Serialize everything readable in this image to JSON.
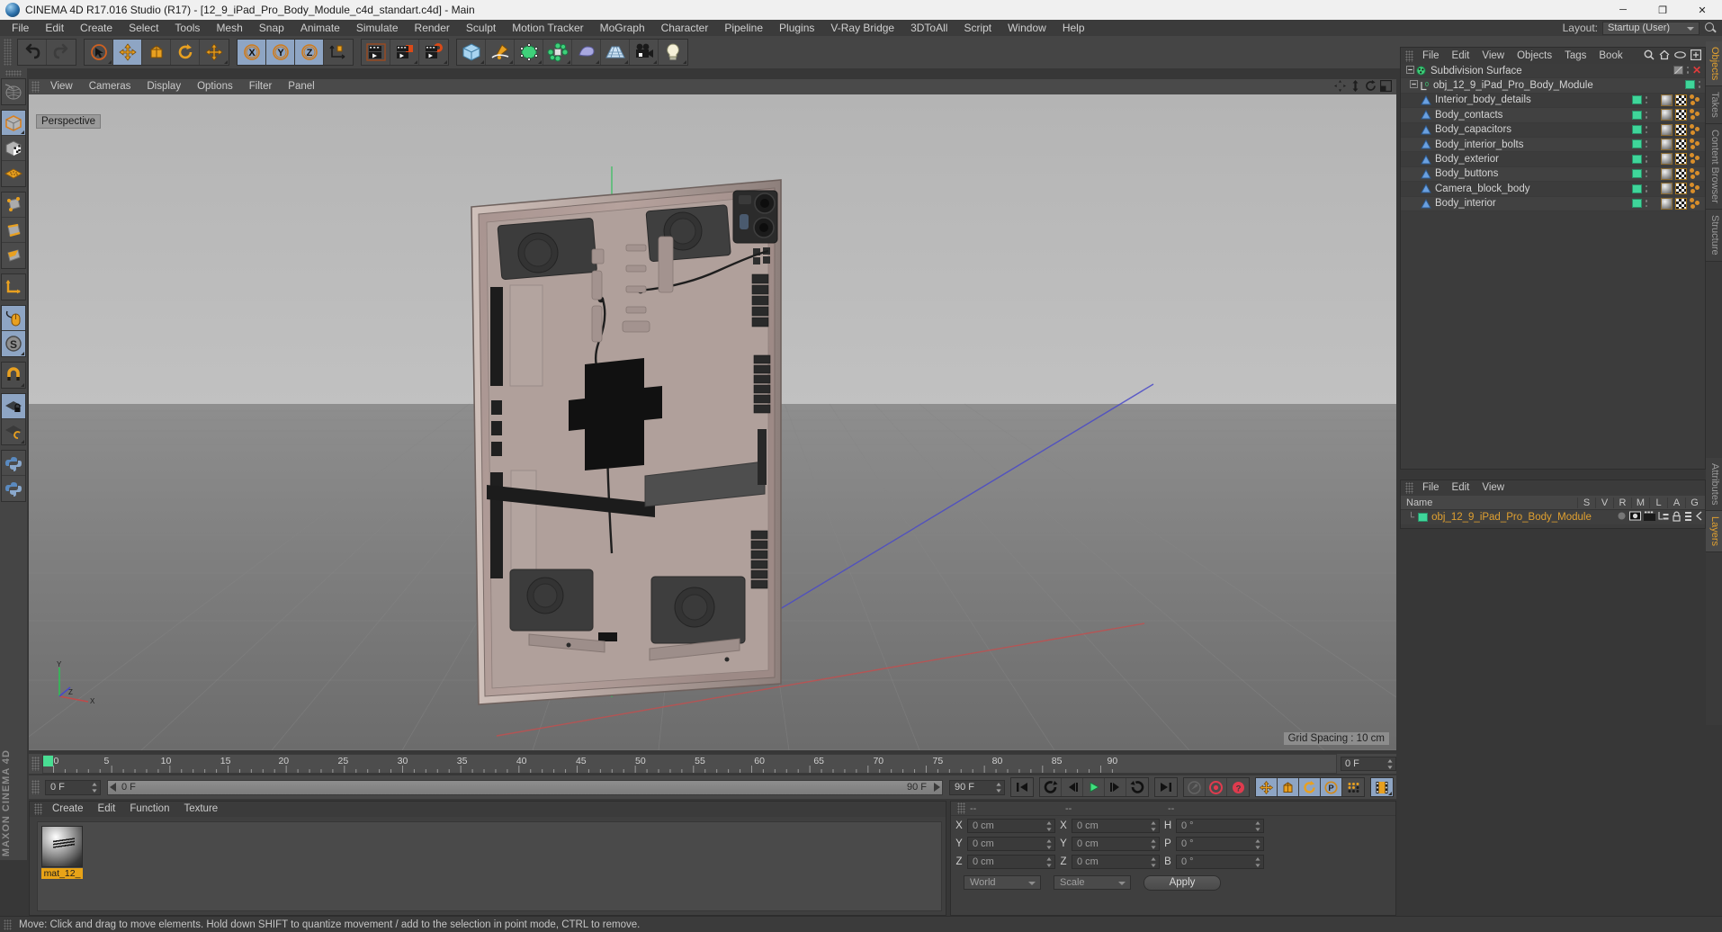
{
  "window": {
    "title": "CINEMA 4D R17.016 Studio (R17) - [12_9_iPad_Pro_Body_Module_c4d_standart.c4d] - Main",
    "minimize": "─",
    "maximize": "❐",
    "close": "✕",
    "app_icon": "cinema4d-logo-icon"
  },
  "menubar": {
    "items": [
      {
        "label": "File"
      },
      {
        "label": "Edit"
      },
      {
        "label": "Create"
      },
      {
        "label": "Select"
      },
      {
        "label": "Tools"
      },
      {
        "label": "Mesh"
      },
      {
        "label": "Snap"
      },
      {
        "label": "Animate"
      },
      {
        "label": "Simulate"
      },
      {
        "label": "Render"
      },
      {
        "label": "Sculpt"
      },
      {
        "label": "Motion Tracker"
      },
      {
        "label": "MoGraph"
      },
      {
        "label": "Character"
      },
      {
        "label": "Pipeline"
      },
      {
        "label": "Plugins"
      },
      {
        "label": "V-Ray Bridge"
      },
      {
        "label": "3DToAll"
      },
      {
        "label": "Script"
      },
      {
        "label": "Window"
      },
      {
        "label": "Help"
      }
    ],
    "layout_label": "Layout:",
    "layout_value": "Startup (User)"
  },
  "toolbar": {
    "groups": [
      {
        "buttons": [
          {
            "name": "undo-button",
            "icon": "undo-icon",
            "active": false
          },
          {
            "name": "redo-button",
            "icon": "redo-icon",
            "active": false
          }
        ]
      },
      {
        "buttons": [
          {
            "name": "live-selection-button",
            "icon": "cursor-select-icon",
            "active": false
          },
          {
            "name": "move-button",
            "icon": "move-arrows-icon",
            "active": true
          },
          {
            "name": "scale-button",
            "icon": "scale-box-icon",
            "active": false
          },
          {
            "name": "rotate-button",
            "icon": "rotate-icon",
            "active": false
          },
          {
            "name": "dynamic-place-button",
            "icon": "move-arrows-icon",
            "active": false
          }
        ]
      },
      {
        "buttons": [
          {
            "name": "axis-x-button",
            "icon": "axis-x-icon",
            "active": true
          },
          {
            "name": "axis-y-button",
            "icon": "axis-y-icon",
            "active": true
          },
          {
            "name": "axis-z-button",
            "icon": "axis-z-icon",
            "active": true
          },
          {
            "name": "world-coordinates-button",
            "icon": "world-axis-cube-icon",
            "active": false
          }
        ]
      },
      {
        "buttons": [
          {
            "name": "render-view-button",
            "icon": "clapper-icon",
            "active": false
          },
          {
            "name": "render-to-picture-viewer-button",
            "icon": "clapper-red-icon",
            "active": false
          },
          {
            "name": "render-settings-button",
            "icon": "clapper-gear-icon",
            "active": false
          }
        ]
      },
      {
        "buttons": [
          {
            "name": "add-cube-button",
            "icon": "blue-cube-icon",
            "active": false
          },
          {
            "name": "add-spline-button",
            "icon": "pen-spline-icon",
            "active": false
          },
          {
            "name": "add-generator-button",
            "icon": "green-cube-icon",
            "active": false
          },
          {
            "name": "add-cloner-button",
            "icon": "mograph-cluster-icon",
            "active": false
          },
          {
            "name": "add-deformer-button",
            "icon": "bend-deformer-icon",
            "active": false
          },
          {
            "name": "add-scene-object-button",
            "icon": "floor-grid-icon",
            "active": false
          },
          {
            "name": "add-camera-button",
            "icon": "camera-icon",
            "active": false
          },
          {
            "name": "add-light-button",
            "icon": "light-bulb-icon",
            "active": false
          }
        ]
      }
    ]
  },
  "left_toolbar": {
    "buttons": [
      {
        "name": "live-selection-tool",
        "icon": "globe-selection-icon",
        "active": false
      },
      {
        "name": "model-mode-tool",
        "icon": "model-cube-icon",
        "active": true
      },
      {
        "name": "texture-mode-tool",
        "icon": "texture-cube-icon",
        "active": false
      },
      {
        "name": "workplane-mode-tool",
        "icon": "workplane-grid-icon",
        "active": false
      },
      {
        "name": "points-mode-tool",
        "icon": "points-cube-icon",
        "active": false
      },
      {
        "name": "edges-mode-tool",
        "icon": "edges-cube-icon",
        "active": false
      },
      {
        "name": "polygons-mode-tool",
        "icon": "polygons-cube-icon",
        "active": false
      },
      {
        "name": "object-axis-tool",
        "icon": "axis-corner-icon",
        "active": false
      },
      {
        "name": "viewport-solo-tool",
        "icon": "mouse-icon",
        "active": true
      },
      {
        "name": "enable-snap-tool",
        "icon": "snap-s-icon",
        "active": true
      },
      {
        "name": "magnet-tool",
        "icon": "magnet-icon",
        "active": false
      },
      {
        "name": "workplane-lock-tool",
        "icon": "grid-lock-icon",
        "active": true
      },
      {
        "name": "workplane-align-tool",
        "icon": "grid-rotate-icon",
        "active": false
      },
      {
        "name": "python-script-tool-1",
        "icon": "python-icon",
        "active": false
      },
      {
        "name": "python-script-tool-2",
        "icon": "python-icon",
        "active": false
      }
    ],
    "brand": "MAXON CINEMA 4D"
  },
  "viewport": {
    "menu": [
      {
        "label": "View"
      },
      {
        "label": "Cameras"
      },
      {
        "label": "Display"
      },
      {
        "label": "Options"
      },
      {
        "label": "Filter"
      },
      {
        "label": "Panel"
      }
    ],
    "corner_icons": [
      {
        "name": "viewport-move-icon"
      },
      {
        "name": "viewport-scale-icon"
      },
      {
        "name": "viewport-rotate-icon"
      },
      {
        "name": "viewport-maximize-icon"
      }
    ],
    "camera_label": "Perspective",
    "grid_spacing": "Grid Spacing : 10 cm",
    "axis_labels": {
      "x": "X",
      "y": "Y",
      "z": "Z"
    },
    "model_description": "12.9 inch iPad Pro body module, rear interior view with speakers, camera block, logic board cutouts"
  },
  "object_manager": {
    "menu": [
      {
        "label": "File"
      },
      {
        "label": "Edit"
      },
      {
        "label": "View"
      },
      {
        "label": "Objects"
      },
      {
        "label": "Tags"
      },
      {
        "label": "Book"
      }
    ],
    "header_icons": [
      {
        "name": "search-icon"
      },
      {
        "name": "home-icon"
      },
      {
        "name": "eye-icon"
      },
      {
        "name": "expand-icon"
      }
    ],
    "rows": [
      {
        "label": "Subdivision Surface",
        "icon": "subdivision-surface-icon",
        "indent": 0,
        "enabled": "disabled",
        "has_tags": false,
        "disabled_mark": "✕"
      },
      {
        "label": "obj_12_9_iPad_Pro_Body_Module",
        "icon": "null-object-icon",
        "indent": 1,
        "enabled": "enabled",
        "has_tags": false
      },
      {
        "label": "Interior_body_details",
        "icon": "polygon-object-icon",
        "indent": 2,
        "enabled": "enabled",
        "has_tags": true
      },
      {
        "label": "Body_contacts",
        "icon": "polygon-object-icon",
        "indent": 2,
        "enabled": "enabled",
        "has_tags": true
      },
      {
        "label": "Body_capacitors",
        "icon": "polygon-object-icon",
        "indent": 2,
        "enabled": "enabled",
        "has_tags": true
      },
      {
        "label": "Body_interior_bolts",
        "icon": "polygon-object-icon",
        "indent": 2,
        "enabled": "enabled",
        "has_tags": true
      },
      {
        "label": "Body_exterior",
        "icon": "polygon-object-icon",
        "indent": 2,
        "enabled": "enabled",
        "has_tags": true
      },
      {
        "label": "Body_buttons",
        "icon": "polygon-object-icon",
        "indent": 2,
        "enabled": "enabled",
        "has_tags": true
      },
      {
        "label": "Camera_block_body",
        "icon": "polygon-object-icon",
        "indent": 2,
        "enabled": "enabled",
        "has_tags": true
      },
      {
        "label": "Body_interior",
        "icon": "polygon-object-icon",
        "indent": 2,
        "enabled": "enabled",
        "has_tags": true
      }
    ]
  },
  "vertical_tabs": [
    {
      "label": "Objects",
      "selected": true
    },
    {
      "label": "Takes",
      "selected": false
    },
    {
      "label": "Content Browser",
      "selected": false
    },
    {
      "label": "Structure",
      "selected": false
    },
    {
      "label": "Attributes",
      "selected": false
    },
    {
      "label": "Layers",
      "selected": true
    }
  ],
  "layer_manager": {
    "menu": [
      {
        "label": "File"
      },
      {
        "label": "Edit"
      },
      {
        "label": "View"
      }
    ],
    "columns": [
      "Name",
      "S",
      "V",
      "R",
      "M",
      "L",
      "A",
      "G"
    ],
    "rows": [
      {
        "name": "obj_12_9_iPad_Pro_Body_Module",
        "color": "#3fd69a"
      }
    ]
  },
  "timeline": {
    "ticks": [
      0,
      5,
      10,
      15,
      20,
      25,
      30,
      35,
      40,
      45,
      50,
      55,
      60,
      65,
      70,
      75,
      80,
      85,
      90
    ],
    "start_frame": "0 F",
    "current_frame": "0 F",
    "end_frame": "90 F",
    "range_start": "0 F",
    "range_end": "90 F",
    "playhead_frame": 0,
    "right_frame_field": "0 F",
    "transport": [
      {
        "name": "go-to-start-button",
        "icon": "skip-back-icon"
      },
      {
        "name": "play-backwards-button",
        "icon": "rewind-loop-icon"
      },
      {
        "name": "previous-frame-button",
        "icon": "step-back-icon"
      },
      {
        "name": "play-button",
        "icon": "play-icon"
      },
      {
        "name": "next-frame-button",
        "icon": "step-forward-icon"
      },
      {
        "name": "play-forwards-button",
        "icon": "loop-forward-icon"
      },
      {
        "name": "go-to-end-button",
        "icon": "skip-forward-icon"
      }
    ],
    "record_group": [
      {
        "name": "autokey-button",
        "icon": "key-icon",
        "active": false
      },
      {
        "name": "record-active-objects-button",
        "icon": "record-red-icon",
        "active": false
      },
      {
        "name": "keyframe-selection-button",
        "icon": "question-red-icon",
        "active": false
      }
    ],
    "anim_flags": [
      {
        "name": "position-key-button",
        "icon": "move-arrows-icon",
        "active": true
      },
      {
        "name": "scale-key-button",
        "icon": "scale-box-icon",
        "active": true
      },
      {
        "name": "rotation-key-button",
        "icon": "rotate-icon",
        "active": true
      },
      {
        "name": "parameter-key-button",
        "icon": "param-p-icon",
        "active": true
      },
      {
        "name": "point-level-animation-button",
        "icon": "dot-grid-icon",
        "active": false
      }
    ],
    "extra": [
      {
        "name": "timeline-view-button",
        "icon": "film-strip-icon",
        "active": true
      }
    ]
  },
  "material_manager": {
    "menu": [
      {
        "label": "Create"
      },
      {
        "label": "Edit"
      },
      {
        "label": "Function"
      },
      {
        "label": "Texture"
      }
    ],
    "materials": [
      {
        "name": "mat_12_",
        "preview": "chrome-sphere-icon",
        "selected": true
      }
    ]
  },
  "coordinates": {
    "headers": [
      "--",
      "--",
      "--"
    ],
    "position": {
      "label_x": "X",
      "label_y": "Y",
      "label_z": "Z",
      "x": "0 cm",
      "y": "0 cm",
      "z": "0 cm"
    },
    "size": {
      "label_x": "X",
      "label_y": "Y",
      "label_z": "Z",
      "x": "0 cm",
      "y": "0 cm",
      "z": "0 cm"
    },
    "rotation": {
      "label_h": "H",
      "label_p": "P",
      "label_b": "B",
      "h": "0 °",
      "p": "0 °",
      "b": "0 °"
    },
    "coord_system": "World",
    "size_mode": "Scale",
    "apply_label": "Apply"
  },
  "statusbar": {
    "text": "Move: Click and drag to move elements. Hold down SHIFT to quantize movement / add to the selection in point mode, CTRL to remove."
  },
  "colors": {
    "accent_orange": "#e0a030",
    "green_enable": "#3fd69a",
    "blue_active": "#8ea5c4",
    "panel_bg": "#3c3c3c",
    "toolbar_bg": "#454545",
    "titlebar_bg": "#f0f0f0",
    "playhead_green": "#49de93",
    "material_label": "#e8a317"
  }
}
